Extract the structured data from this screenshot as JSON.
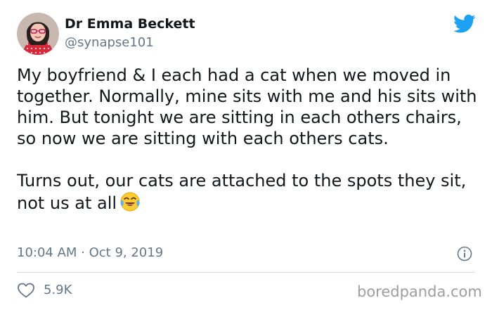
{
  "author": {
    "name": "Dr Emma Beckett",
    "handle": "@synapse101"
  },
  "tweet": {
    "paragraph_1": "My boyfriend & I each had a cat when we moved in together. Normally, mine sits with me and his sits with him. But tonight we are sitting in each others chairs, so now we are sitting with each others cats.",
    "paragraph_2": "Turns out, our cats are attached to the spots they sit, not us at all",
    "emoji": "face-with-tears-of-joy"
  },
  "meta": {
    "timestamp": "10:04 AM · Oct 9, 2019"
  },
  "engagement": {
    "likes": "5.9K"
  },
  "watermark": "boredpanda.com",
  "colors": {
    "twitter_blue": "#1da1f2",
    "text": "#14171a",
    "secondary_text": "#657786",
    "divider": "#cfd9de",
    "watermark": "#9e9e9e"
  },
  "icons": {
    "brand": "twitter-bird-icon",
    "info": "info-icon",
    "like": "heart-icon"
  }
}
